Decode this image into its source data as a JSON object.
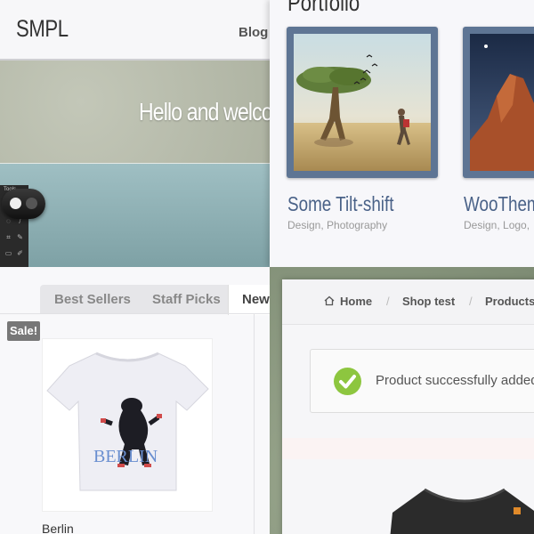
{
  "smpl": {
    "logo": "SMPL",
    "nav_item": "Blog",
    "hero_text": "Hello and welco",
    "tools_title": "Tools"
  },
  "portfolio": {
    "title": "Portfolio",
    "items": [
      {
        "title": "Some Tilt-shift",
        "categories": "Design, Photography"
      },
      {
        "title": "WooTheme",
        "categories": "Design, Logo,"
      }
    ],
    "frame_color": "#5e7594",
    "title_color": "#4a6288"
  },
  "shop": {
    "tabs": [
      "Best Sellers",
      "Staff Picks",
      "New"
    ],
    "active_tab": "New",
    "sale_badge": "Sale!",
    "product_name": "Berlin",
    "shirt_print": "BERLIN"
  },
  "woo": {
    "breadcrumb": [
      "Home",
      "Shop test",
      "Products"
    ],
    "separator": "/",
    "notice": "Product successfully added",
    "check_color": "#8dc63f"
  }
}
